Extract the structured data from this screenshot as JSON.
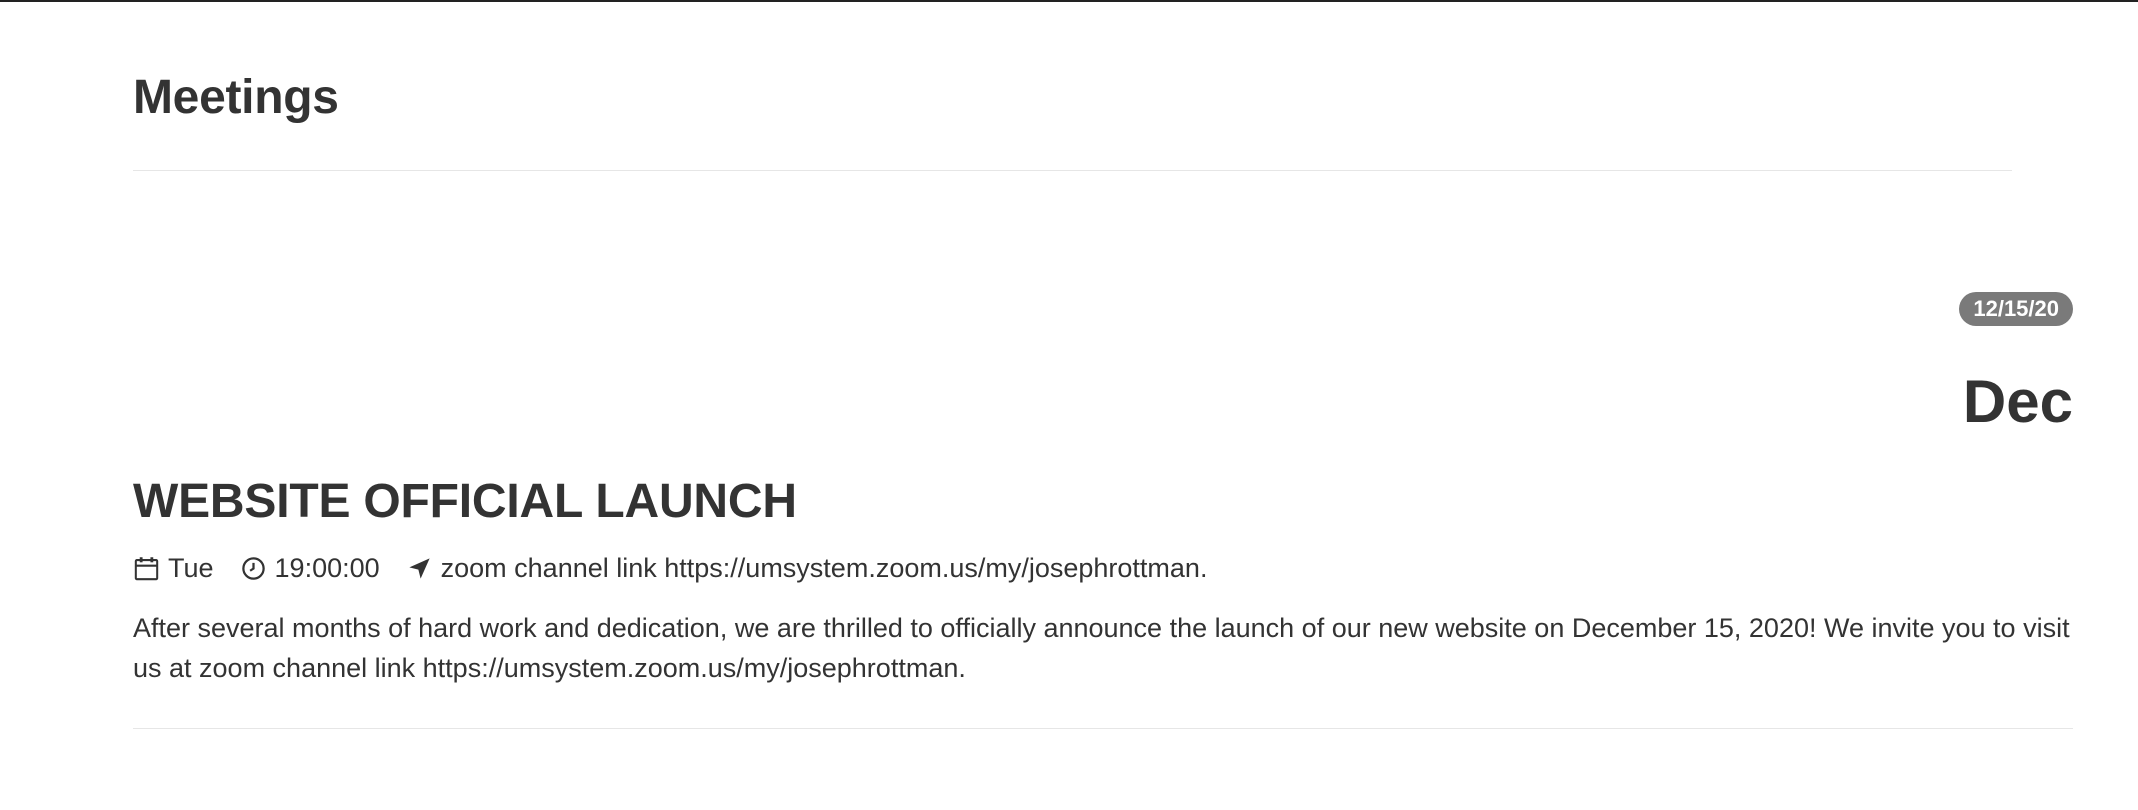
{
  "page": {
    "title": "Meetings"
  },
  "event": {
    "date_badge": "12/15/20",
    "month": "Dec",
    "title": "WEBSITE OFFICIAL LAUNCH",
    "day": "Tue",
    "time": "19:00:00",
    "location": "zoom channel link https://umsystem.zoom.us/my/josephrottman.",
    "description": "After several months of hard work and dedication, we are thrilled to officially announce the launch of our new website on December 15, 2020! We invite you to visit us at zoom channel link https://umsystem.zoom.us/my/josephrottman.",
    "icons": {
      "day": "calendar-icon",
      "time": "clock-icon",
      "location": "location-arrow-icon"
    }
  },
  "colors": {
    "text": "#333333",
    "badge_bg": "#7a7a7a",
    "divider": "#e6e6e6"
  }
}
